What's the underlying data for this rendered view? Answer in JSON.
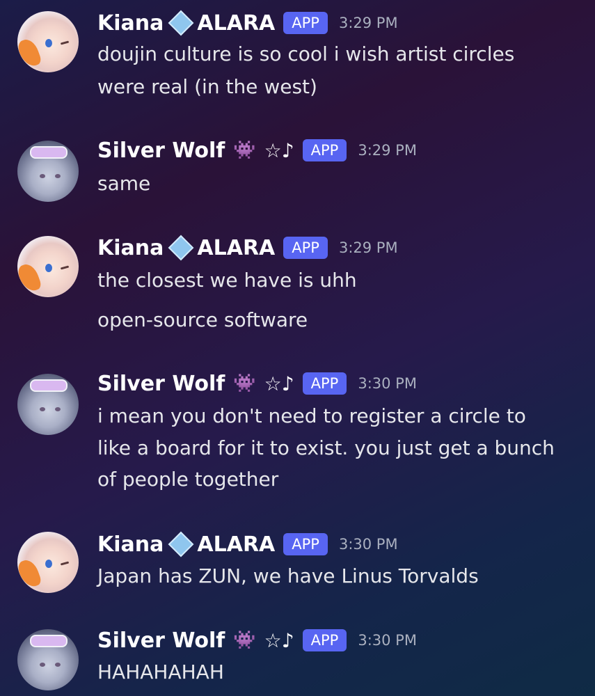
{
  "messages": [
    {
      "author": "Kiana",
      "tag": "ALARA",
      "badge": "APP",
      "time": "3:29 PM",
      "lines": [
        "doujin culture is so cool i wish artist circles",
        "were real (in the west)"
      ]
    },
    {
      "author": "Silver Wolf",
      "deco": "☆♪",
      "badge": "APP",
      "time": "3:29 PM",
      "lines": [
        "same"
      ]
    },
    {
      "author": "Kiana",
      "tag": "ALARA",
      "badge": "APP",
      "time": "3:29 PM",
      "lines": [
        "the closest we have is uhh",
        "open-source software"
      ]
    },
    {
      "author": "Silver Wolf",
      "deco": "☆♪",
      "badge": "APP",
      "time": "3:30 PM",
      "lines": [
        "i mean you don't need to register a circle to",
        "like a board for it to exist. you just get a bunch",
        "of people together"
      ]
    },
    {
      "author": "Kiana",
      "tag": "ALARA",
      "badge": "APP",
      "time": "3:30 PM",
      "lines": [
        "Japan has ZUN, we have Linus Torvalds"
      ]
    },
    {
      "author": "Silver Wolf",
      "deco": "☆♪",
      "badge": "APP",
      "time": "3:30 PM",
      "lines": [
        "HAHAHAHAH"
      ]
    }
  ],
  "icons": {
    "server_tag": "diamond-icon",
    "wolf_emoji": "space-invader-icon"
  }
}
